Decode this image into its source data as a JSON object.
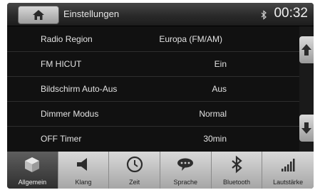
{
  "header": {
    "title": "Einstellungen",
    "clock": "00:32",
    "home_icon": "home-icon",
    "status_icon": "bluetooth-icon"
  },
  "settings": [
    {
      "label": "Radio Region",
      "value": "Europa (FM/AM)"
    },
    {
      "label": "FM HICUT",
      "value": "Ein"
    },
    {
      "label": "Bildschirm Auto-Aus",
      "value": "Aus"
    },
    {
      "label": "Dimmer Modus",
      "value": "Normal"
    },
    {
      "label": "OFF Timer",
      "value": "30min"
    }
  ],
  "scroll": {
    "up_icon": "arrow-up-icon",
    "down_icon": "arrow-down-icon"
  },
  "tabs": [
    {
      "label": "Allgemein",
      "icon": "cube-icon",
      "active": true
    },
    {
      "label": "Klang",
      "icon": "speaker-icon",
      "active": false
    },
    {
      "label": "Zeit",
      "icon": "clock-icon",
      "active": false
    },
    {
      "label": "Sprache",
      "icon": "speech-bubble-icon",
      "active": false
    },
    {
      "label": "Bluetooth",
      "icon": "bluetooth-icon",
      "active": false
    },
    {
      "label": "Lautstärke",
      "icon": "volume-bars-icon",
      "active": false
    }
  ],
  "colors": {
    "background": "#0f0f0f",
    "text": "#e2e2e2",
    "tabbar": "#c0c0c0",
    "active_tab": "#3c3c3c"
  }
}
